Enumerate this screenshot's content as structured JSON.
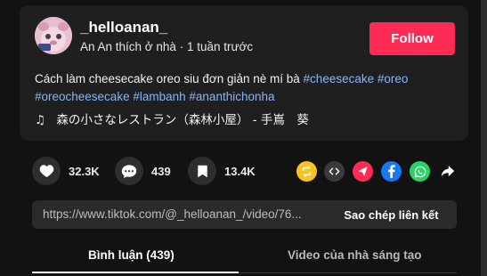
{
  "author": {
    "username": "_helloanan_",
    "display_name": "An An thích ở nhà",
    "separator": "·",
    "posted": "1 tuần trước",
    "follow_label": "Follow"
  },
  "description": {
    "text": "Cách làm cheesecake oreo siu đơn giản nè mí bà",
    "hashtags": [
      "#cheesecake",
      "#oreo",
      "#oreocheesecake",
      "#lambanh",
      "#ananthichonha"
    ]
  },
  "music": {
    "title": "森の小さなレストラン（森林小屋） - 手嶌　葵"
  },
  "stats": {
    "likes": "32.3K",
    "comments": "439",
    "saves": "13.4K"
  },
  "share_icons": [
    "repost-icon",
    "embed-icon",
    "send-icon",
    "facebook-icon",
    "whatsapp-icon",
    "share-arrow-icon"
  ],
  "link": {
    "url": "https://www.tiktok.com/@_helloanan_/video/76...",
    "copy_label": "Sao chép liên kết"
  },
  "tabs": {
    "comments_label": "Bình luận (439)",
    "creator_videos_label": "Video của nhà sáng tạo"
  },
  "colors": {
    "accent": "#fe2c55",
    "hashtag": "#8ab4f8",
    "repost": "#f7c31c",
    "send": "#fe2c55",
    "facebook": "#1877f2",
    "whatsapp": "#25d366"
  }
}
